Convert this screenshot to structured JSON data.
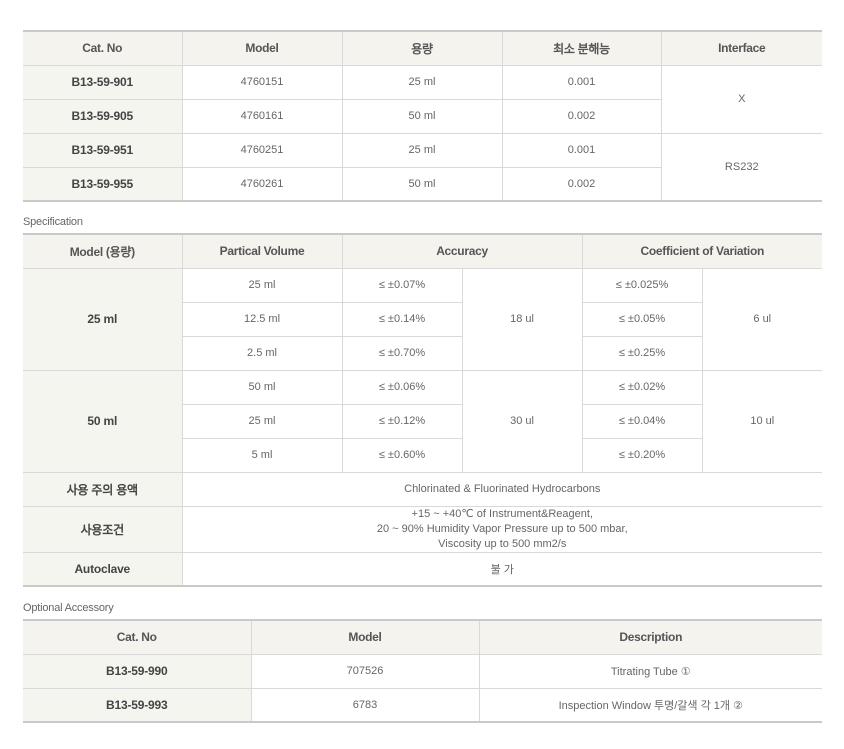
{
  "product_table": {
    "headers": [
      "Cat. No",
      "Model",
      "용량",
      "최소 분해능",
      "Interface"
    ],
    "rows": [
      {
        "cat_no": "B13-59-901",
        "model": "4760151",
        "volume": "25 ml",
        "resolution": "0.001"
      },
      {
        "cat_no": "B13-59-905",
        "model": "4760161",
        "volume": "50 ml",
        "resolution": "0.002"
      },
      {
        "cat_no": "B13-59-951",
        "model": "4760251",
        "volume": "25 ml",
        "resolution": "0.001"
      },
      {
        "cat_no": "B13-59-955",
        "model": "4760261",
        "volume": "50 ml",
        "resolution": "0.002"
      }
    ],
    "interface_groups": [
      "X",
      "RS232"
    ]
  },
  "specification": {
    "caption": "Specification",
    "headers": [
      "Model (용량)",
      "Partical Volume",
      "Accuracy",
      "Coefficient of Variation"
    ],
    "groups": [
      {
        "model": "25 ml",
        "accuracy_abs": "18 ul",
        "cv_abs": "6 ul",
        "rows": [
          {
            "volume": "25 ml",
            "accuracy": "≤ ±0.07%",
            "cv": "≤ ±0.025%"
          },
          {
            "volume": "12.5 ml",
            "accuracy": "≤ ±0.14%",
            "cv": "≤ ±0.05%"
          },
          {
            "volume": "2.5 ml",
            "accuracy": "≤ ±0.70%",
            "cv": "≤ ±0.25%"
          }
        ]
      },
      {
        "model": "50 ml",
        "accuracy_abs": "30 ul",
        "cv_abs": "10 ul",
        "rows": [
          {
            "volume": "50 ml",
            "accuracy": "≤ ±0.06%",
            "cv": "≤ ±0.02%"
          },
          {
            "volume": "25 ml",
            "accuracy": "≤ ±0.12%",
            "cv": "≤ ±0.04%"
          },
          {
            "volume": "5 ml",
            "accuracy": "≤ ±0.60%",
            "cv": "≤ ±0.20%"
          }
        ]
      }
    ],
    "caution_label": "사용 주의 용액",
    "caution_value": "Chlorinated & Fluorinated Hydrocarbons",
    "conditions_label": "사용조건",
    "conditions_lines": [
      "+15 ~ +40℃ of Instrument&Reagent,",
      "20 ~ 90% Humidity Vapor Pressure up to 500 mbar,",
      "Viscosity up to 500 mm2/s"
    ],
    "autoclave_label": "Autoclave",
    "autoclave_value": "불 가"
  },
  "accessory": {
    "caption": "Optional Accessory",
    "headers": [
      "Cat. No",
      "Model",
      "Description"
    ],
    "rows": [
      {
        "cat_no": "B13-59-990",
        "model": "707526",
        "description": "Titrating Tube ①"
      },
      {
        "cat_no": "B13-59-993",
        "model": "6783",
        "description": "Inspection Window 투명/갈색 각 1개 ②"
      }
    ]
  }
}
